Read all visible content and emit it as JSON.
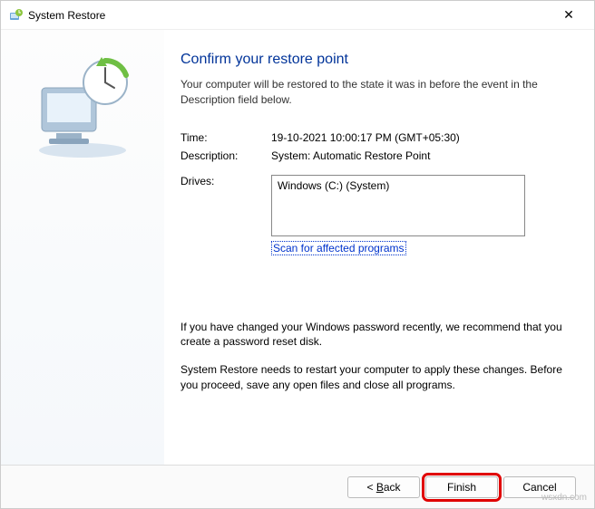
{
  "titlebar": {
    "title": "System Restore",
    "close": "✕"
  },
  "main": {
    "heading": "Confirm your restore point",
    "intro": "Your computer will be restored to the state it was in before the event in the Description field below.",
    "time_label": "Time:",
    "time_value": "19-10-2021 10:00:17 PM (GMT+05:30)",
    "desc_label": "Description:",
    "desc_value": "System: Automatic Restore Point",
    "drives_label": "Drives:",
    "drives_value": "Windows (C:) (System)",
    "scan_link": "Scan for affected programs",
    "note1": "If you have changed your Windows password recently, we recommend that you create a password reset disk.",
    "note2": "System Restore needs to restart your computer to apply these changes. Before you proceed, save any open files and close all programs."
  },
  "buttons": {
    "back_prefix": "< ",
    "back_letter": "B",
    "back_rest": "ack",
    "finish": "Finish",
    "cancel": "Cancel"
  },
  "watermark": "wsxdn.com"
}
